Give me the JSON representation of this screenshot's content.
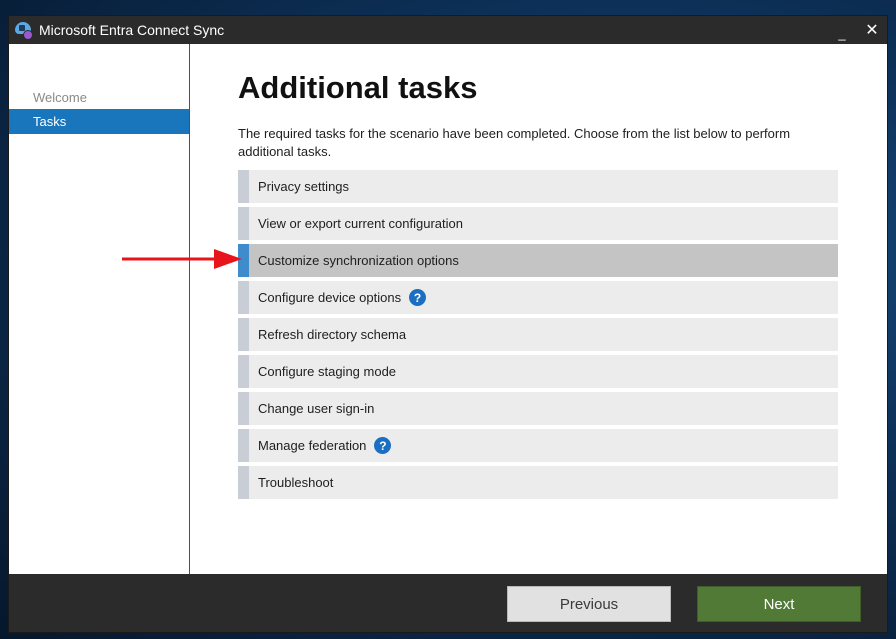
{
  "window": {
    "title": "Microsoft Entra Connect Sync",
    "minimize_glyph": "_",
    "close_glyph": "✕"
  },
  "sidebar": {
    "items": [
      {
        "label": "Welcome",
        "state": "completed"
      },
      {
        "label": "Tasks",
        "state": "active"
      }
    ]
  },
  "main": {
    "title": "Additional tasks",
    "description": "The required tasks for the scenario have been completed. Choose from the list below to perform additional tasks.",
    "tasks": [
      {
        "label": "Privacy settings",
        "selected": false,
        "help": false
      },
      {
        "label": "View or export current configuration",
        "selected": false,
        "help": false
      },
      {
        "label": "Customize synchronization options",
        "selected": true,
        "help": false
      },
      {
        "label": "Configure device options",
        "selected": false,
        "help": true
      },
      {
        "label": "Refresh directory schema",
        "selected": false,
        "help": false
      },
      {
        "label": "Configure staging mode",
        "selected": false,
        "help": false
      },
      {
        "label": "Change user sign-in",
        "selected": false,
        "help": false
      },
      {
        "label": "Manage federation",
        "selected": false,
        "help": true
      },
      {
        "label": "Troubleshoot",
        "selected": false,
        "help": false
      }
    ],
    "help_glyph": "?"
  },
  "footer": {
    "previous_label": "Previous",
    "next_label": "Next"
  },
  "colors": {
    "accent": "#1976bd",
    "selected_bar": "#3f8ccd",
    "next_button": "#517a36",
    "annotation_arrow": "#e8141b"
  },
  "icons": {
    "app": "entra-connect-icon",
    "help": "question-circle-icon",
    "annotation": "red-arrow-icon"
  }
}
